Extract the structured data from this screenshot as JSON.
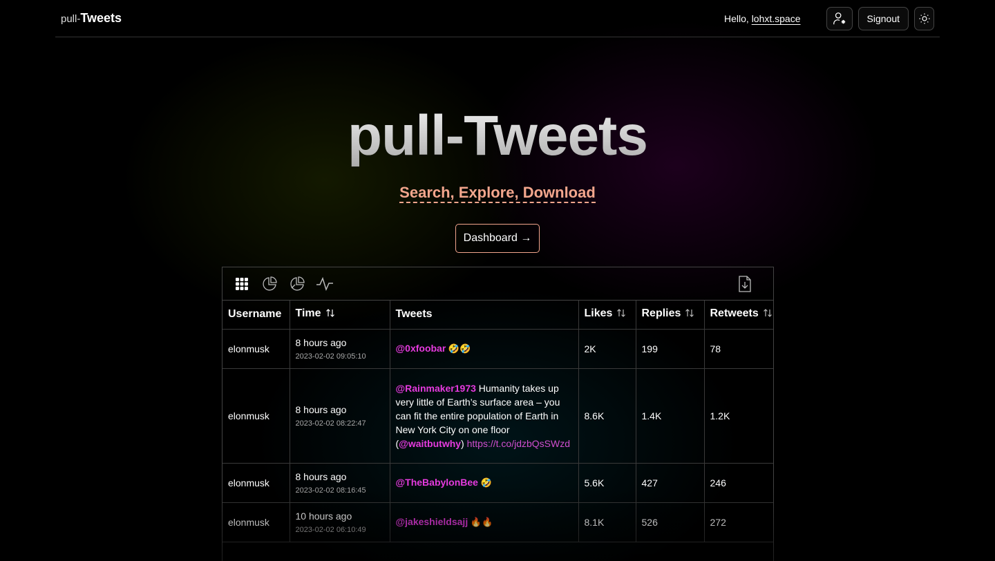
{
  "header": {
    "logo_prefix": "pull-",
    "logo_main": "Tweets",
    "greeting": "Hello,",
    "username": "lohxt.space",
    "signout_label": "Signout"
  },
  "hero": {
    "title": "pull-Tweets",
    "subtitle": "Search, Explore, Download",
    "dashboard_label": "Dashboard →"
  },
  "toolbar": {
    "tools": [
      "grid-icon",
      "pie-chart-icon",
      "pie-chart-alt-icon",
      "activity-icon"
    ],
    "download_icon": "file-download-icon"
  },
  "table": {
    "columns": [
      "Username",
      "Time",
      "Tweets",
      "Likes",
      "Replies",
      "Retweets"
    ],
    "rows": [
      {
        "username": "elonmusk",
        "time_ago": "8 hours ago",
        "timestamp": "2023-02-02 09:05:10",
        "mention": "@0xfoobar",
        "text": " 🤣🤣",
        "likes": "2K",
        "replies": "199",
        "retweets": "78"
      },
      {
        "username": "elonmusk",
        "time_ago": "8 hours ago",
        "timestamp": "2023-02-02 08:22:47",
        "mention": "@Rainmaker1973",
        "text": " Humanity takes up very little of Earth’s surface area – you can fit the entire population of Earth in New York City on one floor (",
        "mention2": "@waitbutwhy",
        "text2": ") ",
        "link": "https://t.co/jdzbQsSWzd",
        "likes": "8.6K",
        "replies": "1.4K",
        "retweets": "1.2K"
      },
      {
        "username": "elonmusk",
        "time_ago": "8 hours ago",
        "timestamp": "2023-02-02 08:16:45",
        "mention": "@TheBabylonBee",
        "text": " 🤣",
        "likes": "5.6K",
        "replies": "427",
        "retweets": "246"
      },
      {
        "username": "elonmusk",
        "time_ago": "10 hours ago",
        "timestamp": "2023-02-02 06:10:49",
        "mention": "@jakeshieldsajj",
        "text": " 🔥🔥",
        "likes": "8.1K",
        "replies": "526",
        "retweets": "272"
      }
    ]
  },
  "colors": {
    "accent_salmon": "#f3a68d",
    "mention_pink": "#e63bdf",
    "border": "#444444"
  }
}
